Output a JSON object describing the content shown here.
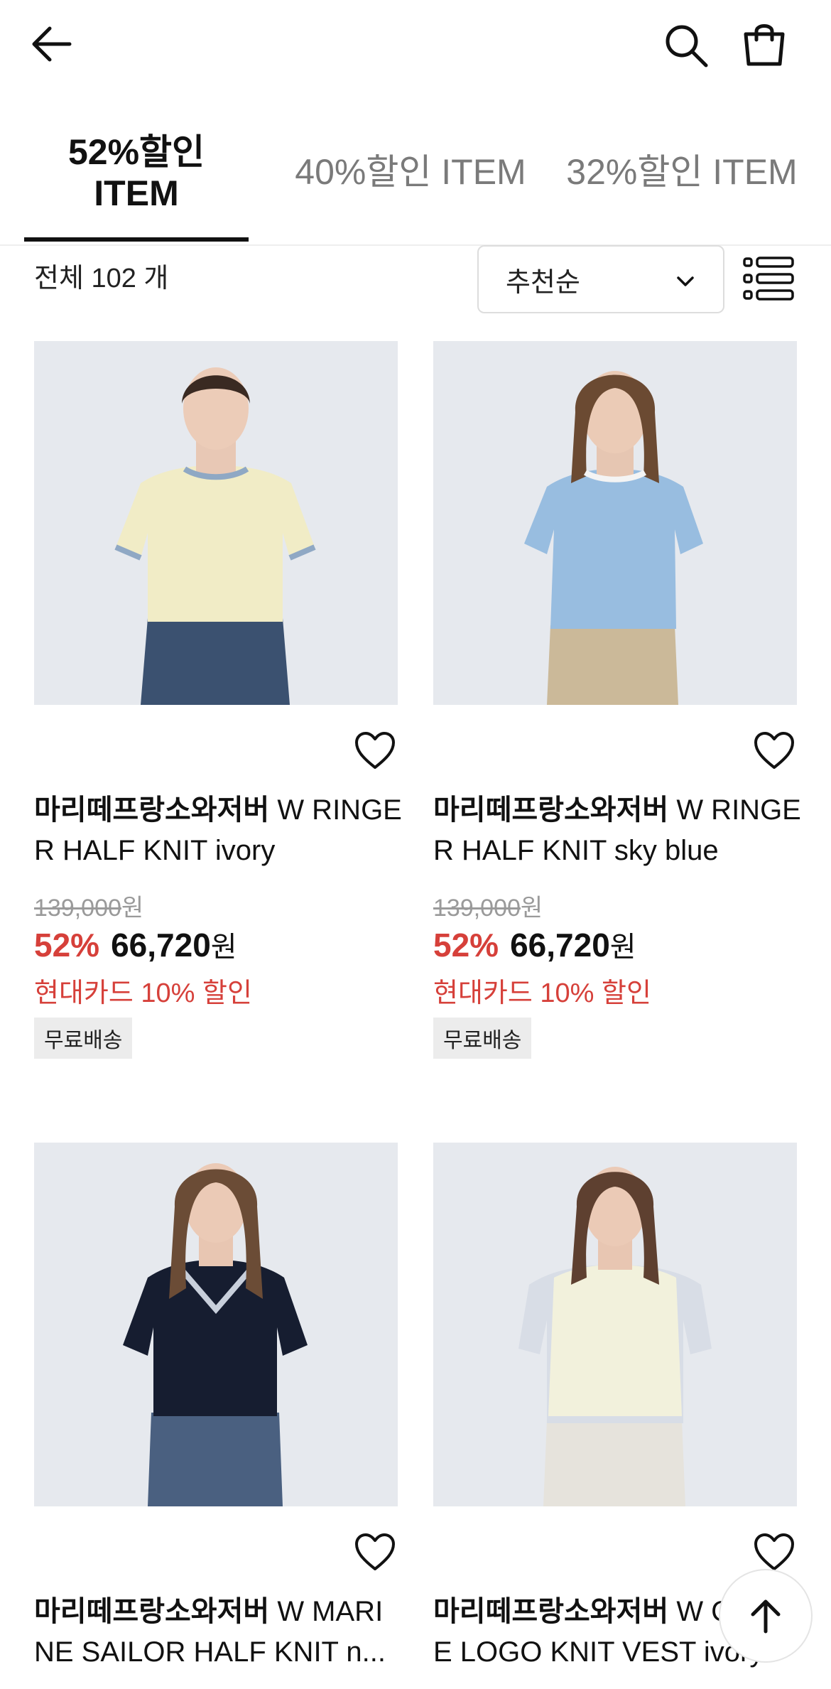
{
  "header": {
    "icons": [
      "back-arrow-icon",
      "search-icon",
      "shopping-bag-icon"
    ]
  },
  "tabs": [
    {
      "label": "52%할인 ITEM",
      "active": true
    },
    {
      "label": "40%할인 ITEM",
      "active": false
    },
    {
      "label": "32%할인 ITEM",
      "active": false
    }
  ],
  "toolbar": {
    "count_label": "전체 102 개",
    "sort_value": "추천순",
    "view_icon": "list-view-icon"
  },
  "products": [
    {
      "brand": "마리떼프랑소와저버",
      "title_line1_rest": " W RINGE",
      "title_line2": "R HALF KNIT ivory",
      "original_price": "139,000",
      "original_unit": "원",
      "discount": "52%",
      "sale_price": "66,720",
      "sale_unit": "원",
      "card_promo": "현대카드 10% 할인",
      "badge": "무료배송",
      "colors": {
        "shirt": "#f1ecc6",
        "trim": "#8fa8c4",
        "bottom": "#3b5170"
      }
    },
    {
      "brand": "마리떼프랑소와저버",
      "title_line1_rest": " W RINGE",
      "title_line2": "R HALF KNIT sky blue",
      "original_price": "139,000",
      "original_unit": "원",
      "discount": "52%",
      "sale_price": "66,720",
      "sale_unit": "원",
      "card_promo": "현대카드 10% 할인",
      "badge": "무료배송",
      "colors": {
        "shirt": "#98bde0",
        "trim": "#f4f4f4",
        "bottom": "#cbb999"
      }
    },
    {
      "brand": "마리떼프랑소와저버",
      "title_line1_rest": " W MARI",
      "title_line2": "NE SAILOR HALF KNIT n...",
      "colors": {
        "shirt": "#161d30",
        "trim": "#c8cfdb",
        "bottom": "#4a6080"
      }
    },
    {
      "brand": "마리떼프랑소와저버",
      "title_line1_rest": " W C",
      "title_line2": "E LOGO KNIT VEST ivory",
      "colors": {
        "shirt": "#f2f1dc",
        "trim": "#d8dde6",
        "bottom": "#e6e3dc"
      }
    }
  ],
  "colors": {
    "accent_red": "#d6403a",
    "text": "#111111",
    "muted": "#7a7a7a"
  }
}
